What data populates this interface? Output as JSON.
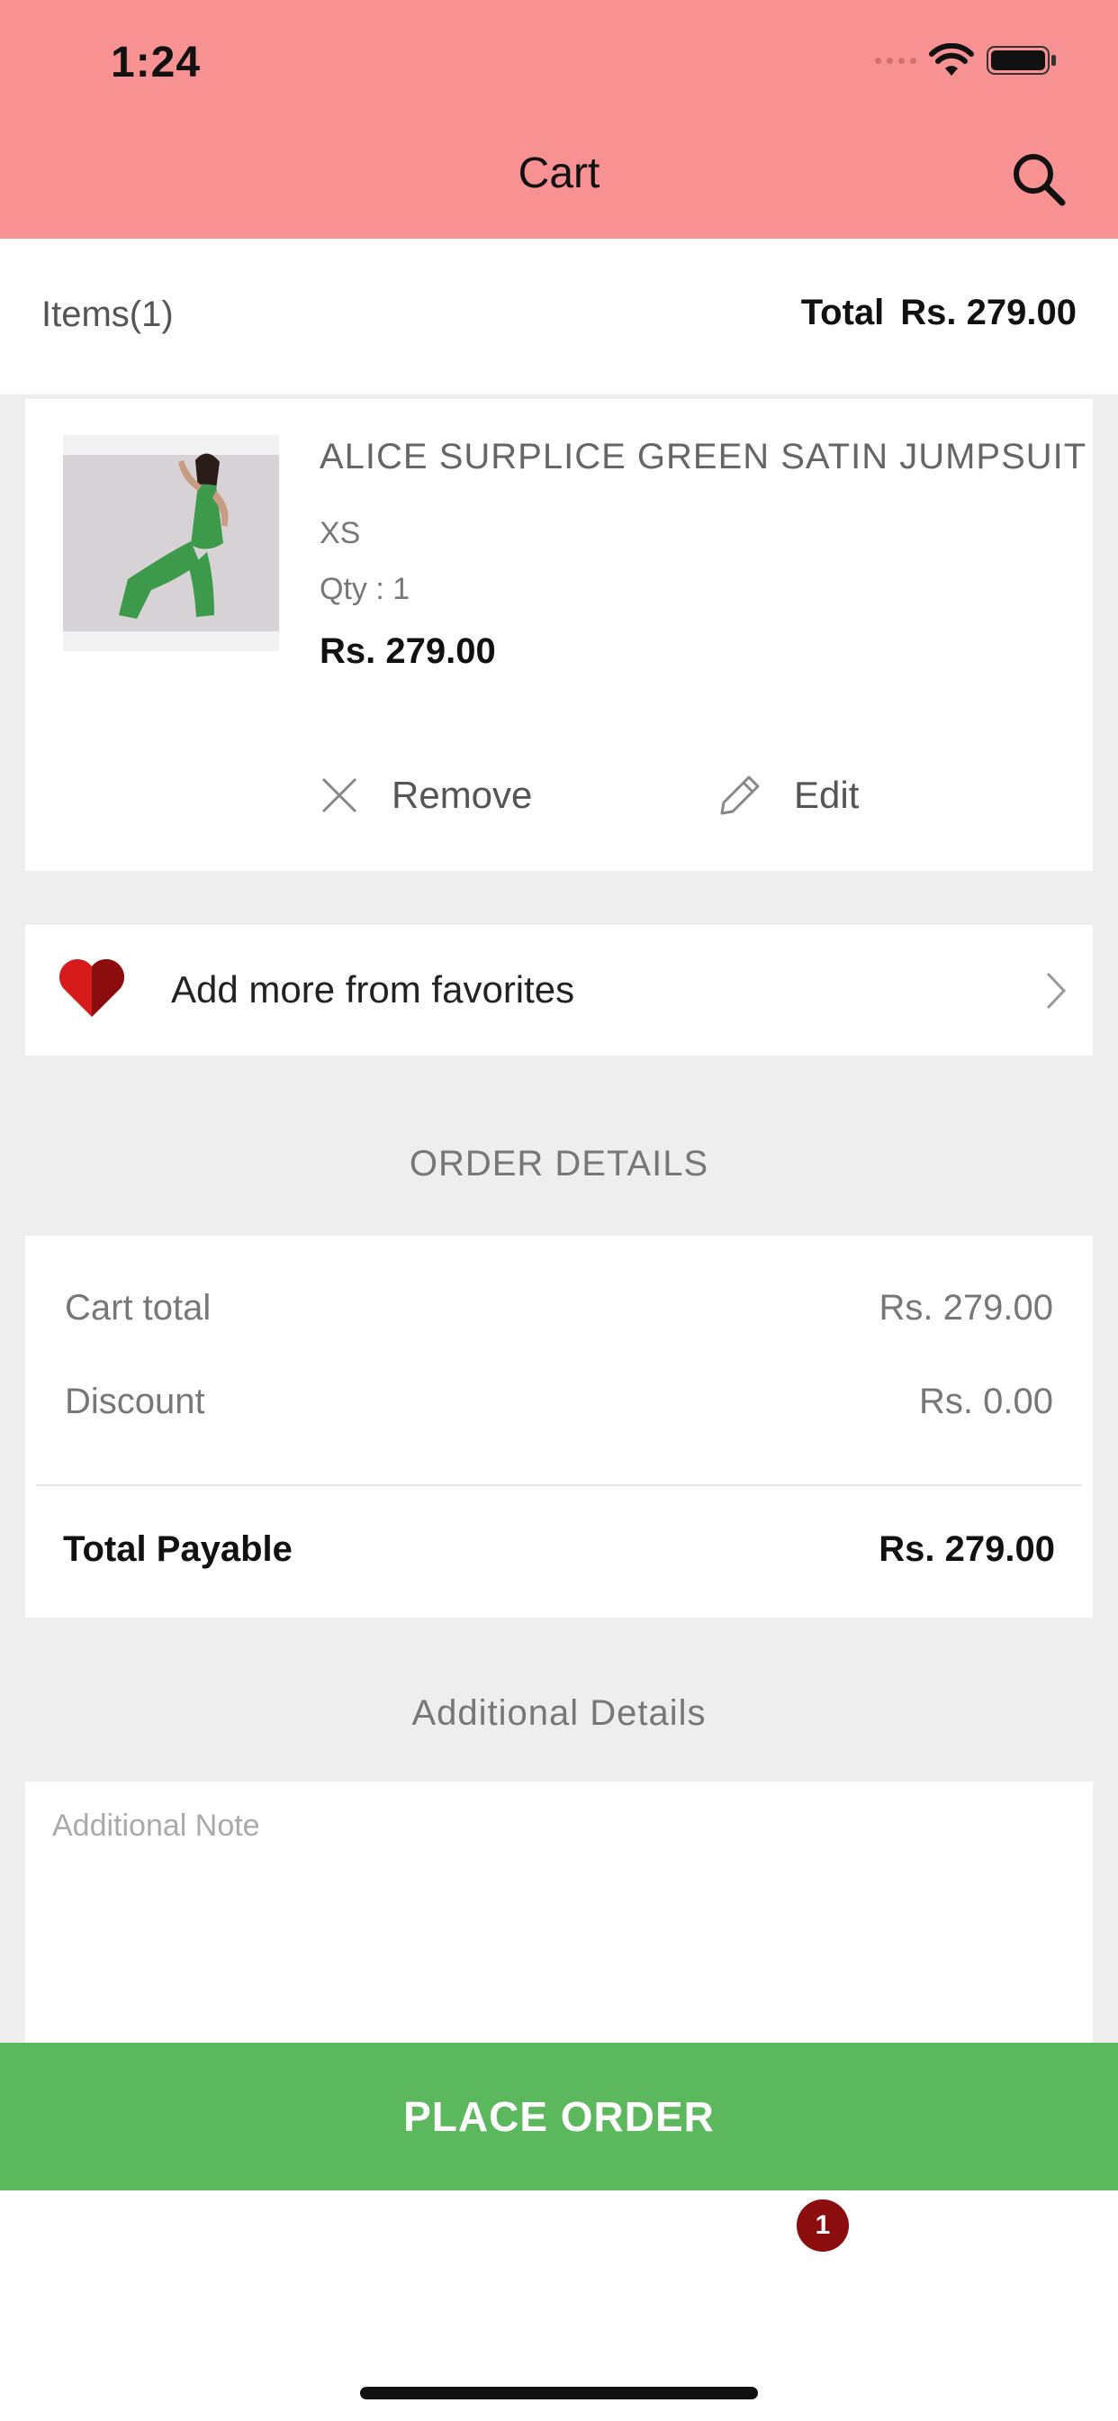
{
  "status_bar": {
    "time": "1:24"
  },
  "header": {
    "title": "Cart",
    "search_icon": "search-icon",
    "bg_color": "#f89292"
  },
  "summary": {
    "items_label": "Items(1)",
    "total_label": "Total",
    "total_value": "Rs. 279.00"
  },
  "product": {
    "name": "ALICE SURPLICE GREEN SATIN JUMPSUIT",
    "size": "XS",
    "qty": "Qty : 1",
    "price": "Rs. 279.00",
    "remove_label": "Remove",
    "edit_label": "Edit"
  },
  "favorites": {
    "label": "Add more from favorites",
    "icon": "heart-icon"
  },
  "order_details": {
    "title": "ORDER DETAILS",
    "cart_total_label": "Cart total",
    "cart_total_value": "Rs. 279.00",
    "discount_label": "Discount",
    "discount_value": "Rs. 0.00",
    "payable_label": "Total Payable",
    "payable_value": "Rs. 279.00"
  },
  "additional": {
    "title": "Additional Details",
    "placeholder": "Additional Note"
  },
  "place_order": {
    "label": "PLACE ORDER",
    "color": "#5cb85c"
  },
  "tab_badge": {
    "count": "1"
  }
}
